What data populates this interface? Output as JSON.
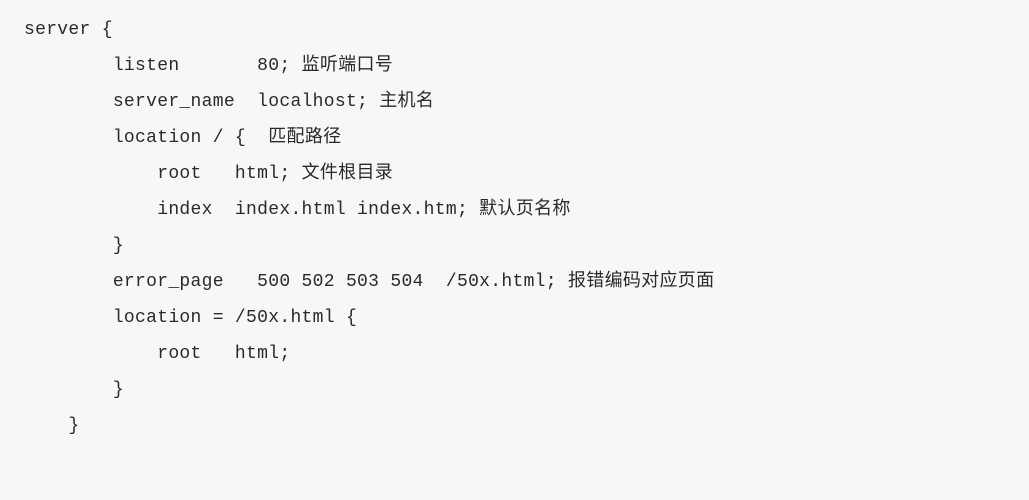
{
  "code": {
    "lines": [
      "server {",
      "        listen       80; 监听端口号",
      "        server_name  localhost; 主机名",
      "        location / {  匹配路径",
      "            root   html; 文件根目录",
      "            index  index.html index.htm; 默认页名称",
      "        }",
      "",
      "",
      "        error_page   500 502 503 504  /50x.html; 报错编码对应页面",
      "        location = /50x.html {",
      "            root   html;",
      "        }",
      "    }"
    ]
  }
}
